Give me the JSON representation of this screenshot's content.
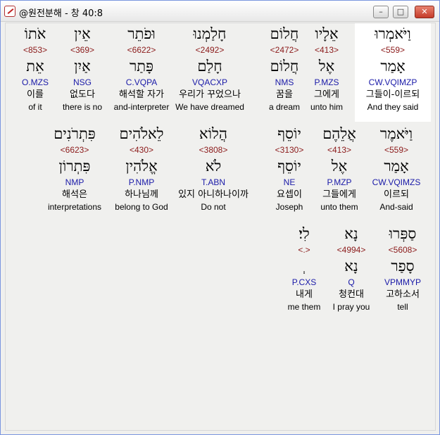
{
  "window": {
    "title": "@원전분해 - 창 40:8",
    "min_label": "–",
    "max_label": "□",
    "close_label": "✕"
  },
  "rows": [
    {
      "words": [
        {
          "heb": "וַיֹּאמְרוּ",
          "num": "<559>",
          "lex": "אָמַר",
          "gram": "CW.VQIMZP",
          "kor": "그들이-이르되",
          "eng": "And they said",
          "selected": true
        },
        {
          "heb": "אֵלָיו",
          "num": "<413>",
          "lex": "אֶל",
          "gram": "P.MZS",
          "kor": "그에게",
          "eng": "unto him"
        },
        {
          "heb": "חֲלוֹם",
          "num": "<2472>",
          "lex": "חֲלוֹם",
          "gram": "NMS",
          "kor": "꿈을",
          "eng": "a dream"
        },
        {
          "heb": "חָלַמְנוּ",
          "num": "<2492>",
          "lex": "חָלַם",
          "gram": "VQACXP",
          "kor": "우리가 꾸었으나",
          "eng": "We have dreamed"
        },
        {
          "heb": "וּפֹתֵר",
          "num": "<6622>",
          "lex": "פָּתַר",
          "gram": "C.VQPA",
          "kor": "해석할 자가",
          "eng": "and-interpreter"
        },
        {
          "heb": "אֵין",
          "num": "<369>",
          "lex": "אַיִן",
          "gram": "NSG",
          "kor": "없도다",
          "eng": "there is no"
        },
        {
          "heb": "אֹתוֹ",
          "num": "<853>",
          "lex": "אֵת",
          "gram": "O.MZS",
          "kor": "이를",
          "eng": "of it"
        }
      ]
    },
    {
      "words": [
        {
          "heb": "וַיֹּאמֶר",
          "num": "<559>",
          "lex": "אָמַר",
          "gram": "CW.VQIMZS",
          "kor": "이르되",
          "eng": "And-said"
        },
        {
          "heb": "אֲלֵהֶם",
          "num": "<413>",
          "lex": "אֶל",
          "gram": "P.MZP",
          "kor": "그들에게",
          "eng": "unto them"
        },
        {
          "heb": "יוֹסֵף",
          "num": "<3130>",
          "lex": "יוֹסֵף",
          "gram": "NE",
          "kor": "요셉이",
          "eng": "Joseph"
        },
        {
          "heb": "הֲלוֹא",
          "num": "<3808>",
          "lex": "לֹא",
          "gram": "T.ABN",
          "kor": "있지 아니하나이까",
          "eng": "Do not"
        },
        {
          "heb": "לֵאלֹהִים",
          "num": "<430>",
          "lex": "אֱלֹהִין",
          "gram": "P.NMP",
          "kor": "하나님께",
          "eng": "belong to God"
        },
        {
          "heb": "פִּתְרֹנִים",
          "num": "<6623>",
          "lex": "פִּתְרוֹן",
          "gram": "NMP",
          "kor": "해석은",
          "eng": "interpretations"
        }
      ]
    },
    {
      "words": [
        {
          "heb": "סַפְּרוּ",
          "num": "<5608>",
          "lex": "סָפַר",
          "gram": "VPMMYP",
          "kor": "고하소서",
          "eng": "tell"
        },
        {
          "heb": "נָא",
          "num": "<4994>",
          "lex": "נָא",
          "gram": "Q",
          "kor": "청컨대",
          "eng": "I pray you"
        },
        {
          "heb": "לִי׃",
          "num": "<.>",
          "lex": "ְ",
          "gram": "P.CXS",
          "kor": "내게",
          "eng": "me them"
        }
      ]
    }
  ]
}
